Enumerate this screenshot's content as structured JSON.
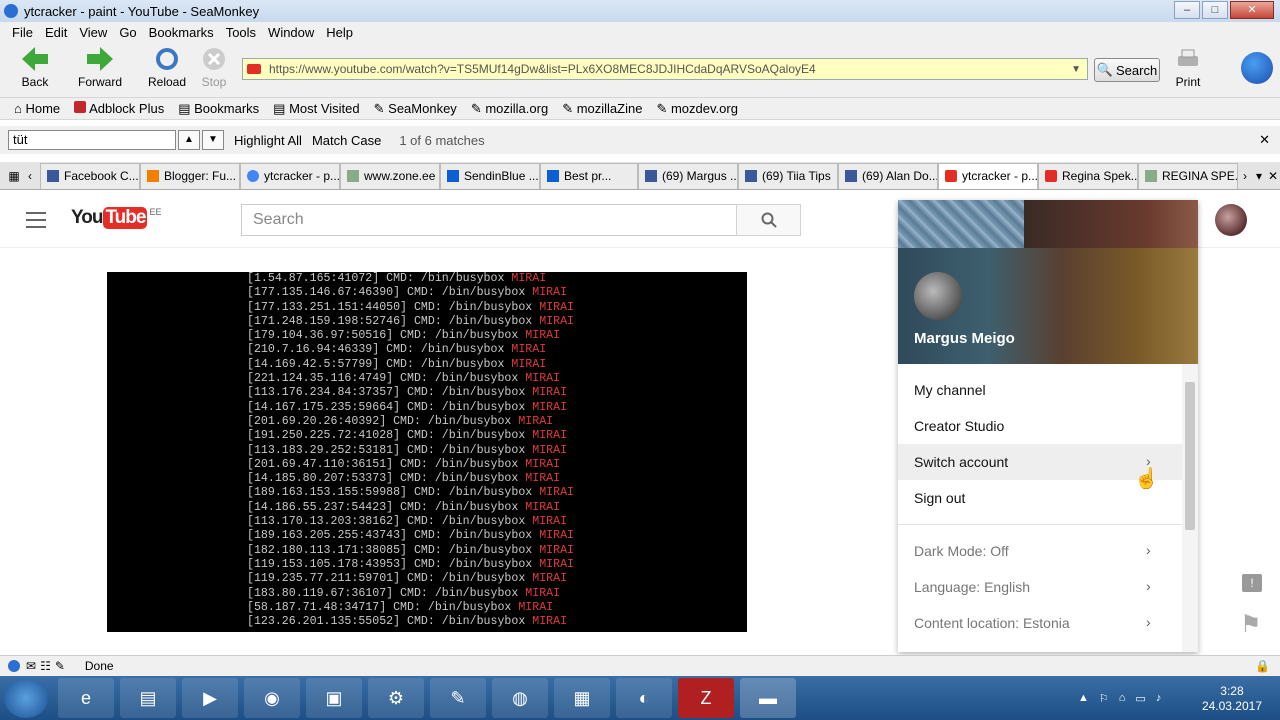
{
  "window": {
    "title": "ytcracker - paint - YouTube - SeaMonkey",
    "minimize": "–",
    "maximize": "□",
    "close": "✕"
  },
  "menubar": [
    "File",
    "Edit",
    "View",
    "Go",
    "Bookmarks",
    "Tools",
    "Window",
    "Help"
  ],
  "toolbar": {
    "back": "Back",
    "forward": "Forward",
    "reload": "Reload",
    "stop": "Stop",
    "print": "Print",
    "search": "Search"
  },
  "url": "https://www.youtube.com/watch?v=TS5MUf14gDw&list=PLx6XO8MEC8JDJIHCdaDqARVSoAQaloyE4",
  "bookmarks": [
    "Home",
    "Adblock Plus",
    "Bookmarks",
    "Most Visited",
    "SeaMonkey",
    "mozilla.org",
    "mozillaZine",
    "mozdev.org"
  ],
  "findbar": {
    "query": "tüt",
    "highlight_all": "Highlight All",
    "match_case": "Match Case",
    "result": "1 of 6 matches",
    "close": "✕"
  },
  "tabs": [
    {
      "label": "Facebook C...",
      "active": false
    },
    {
      "label": "Blogger: Fu...",
      "active": false
    },
    {
      "label": "ytcracker - p...",
      "active": false
    },
    {
      "label": "www.zone.ee",
      "active": false
    },
    {
      "label": "SendinBlue ...",
      "active": false
    },
    {
      "label": "Best pr...",
      "active": false
    },
    {
      "label": "(69) Margus ...",
      "active": false
    },
    {
      "label": "(69) Tiia Tips",
      "active": false
    },
    {
      "label": "(69) Alan Do...",
      "active": false
    },
    {
      "label": "ytcracker - p...",
      "active": true
    },
    {
      "label": "Regina Spek...",
      "active": false
    },
    {
      "label": "REGINA SPE...",
      "active": false
    }
  ],
  "youtube": {
    "logo_you": "You",
    "logo_tube": "Tube",
    "region": "EE",
    "search_placeholder": "Search"
  },
  "video_lines": [
    [
      "[1.54.87.165:41072] CMD: /bin/busybox ",
      "MIRAI"
    ],
    [
      "[177.135.146.67:46390] CMD: /bin/busybox ",
      "MIRAI"
    ],
    [
      "[177.133.251.151:44050] CMD: /bin/busybox ",
      "MIRAI"
    ],
    [
      "[171.248.159.198:52746] CMD: /bin/busybox ",
      "MIRAI"
    ],
    [
      "[179.104.36.97:50516] CMD: /bin/busybox ",
      "MIRAI"
    ],
    [
      "[210.7.16.94:46339] CMD: /bin/busybox ",
      "MIRAI"
    ],
    [
      "[14.169.42.5:57799] CMD: /bin/busybox ",
      "MIRAI"
    ],
    [
      "[221.124.35.116:4749] CMD: /bin/busybox ",
      "MIRAI"
    ],
    [
      "[113.176.234.84:37357] CMD: /bin/busybox ",
      "MIRAI"
    ],
    [
      "[14.167.175.235:59664] CMD: /bin/busybox ",
      "MIRAI"
    ],
    [
      "[201.69.20.26:40392] CMD: /bin/busybox ",
      "MIRAI"
    ],
    [
      "[191.250.225.72:41028] CMD: /bin/busybox ",
      "MIRAI"
    ],
    [
      "[113.183.29.252:53181] CMD: /bin/busybox ",
      "MIRAI"
    ],
    [
      "[201.69.47.110:36151] CMD: /bin/busybox ",
      "MIRAI"
    ],
    [
      "[14.185.80.207:53373] CMD: /bin/busybox ",
      "MIRAI"
    ],
    [
      "[189.163.153.155:59988] CMD: /bin/busybox ",
      "MIRAI"
    ],
    [
      "[14.186.55.237:54423] CMD: /bin/busybox ",
      "MIRAI"
    ],
    [
      "[113.170.13.203:38162] CMD: /bin/busybox ",
      "MIRAI"
    ],
    [
      "[189.163.205.255:43743] CMD: /bin/busybox ",
      "MIRAI"
    ],
    [
      "[182.180.113.171:38085] CMD: /bin/busybox ",
      "MIRAI"
    ],
    [
      "[119.153.105.178:43953] CMD: /bin/busybox ",
      "MIRAI"
    ],
    [
      "[119.235.77.211:59701] CMD: /bin/busybox ",
      "MIRAI"
    ],
    [
      "[183.80.119.67:36107] CMD: /bin/busybox ",
      "MIRAI"
    ],
    [
      "[58.187.71.48:34717] CMD: /bin/busybox ",
      "MIRAI"
    ],
    [
      "[123.26.201.135:55052] CMD: /bin/busybox ",
      "MIRAI"
    ]
  ],
  "account_menu": {
    "name": "Margus Meigo",
    "items": [
      "My channel",
      "Creator Studio",
      "Switch account",
      "Sign out"
    ],
    "settings": [
      "Dark Mode: Off",
      "Language: English",
      "Content location: Estonia"
    ]
  },
  "statusbar": {
    "text": "Done"
  },
  "clock": {
    "time": "3:28",
    "date": "24.03.2017"
  },
  "colors": {
    "youtube_red": "#e52d27",
    "mirai_red": "#e03a3a",
    "taskbar": "#1d4e86"
  }
}
